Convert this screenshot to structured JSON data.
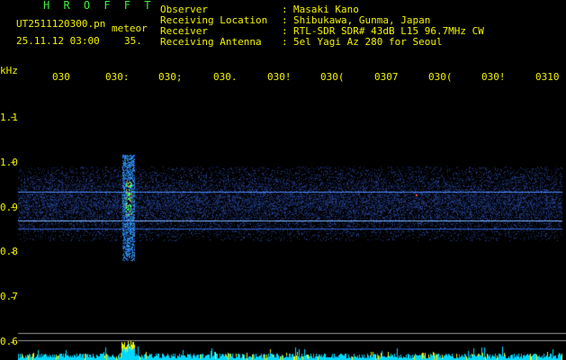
{
  "app": {
    "title": "H R O F F T"
  },
  "info": {
    "filename": "UT2511120300.pn",
    "meteor_label": "meteor",
    "datetime": "25.11.12 03:00",
    "meteor_count": "35.",
    "fields": [
      {
        "label": "Observer",
        "value": "Masaki Kano"
      },
      {
        "label": "Receiving Location",
        "value": "Shibukawa, Gunma, Japan"
      },
      {
        "label": "Receiver",
        "value": "RTL-SDR SDR# 43dB L15 96.7MHz CW"
      },
      {
        "label": "Receiving Antenna",
        "value": "5el Yagi Az 280 for Seoul"
      }
    ],
    "separator": ":"
  },
  "axis": {
    "y_unit": "kHz",
    "y_ticks": [
      "1.1",
      "1.0",
      "0.9",
      "0.8",
      "0.7",
      "0.6"
    ],
    "x_ticks": [
      "030",
      "030:",
      "030;",
      "030.",
      "030!",
      "030(",
      "0307",
      "030(",
      "030!",
      "0310"
    ]
  },
  "colors": {
    "text": "#f2f200",
    "title": "#3cf03c",
    "noise": "#1a3aa0",
    "signal": "#5aa0ff",
    "echo": "#40ff60",
    "meter": "#00e5ff"
  }
}
